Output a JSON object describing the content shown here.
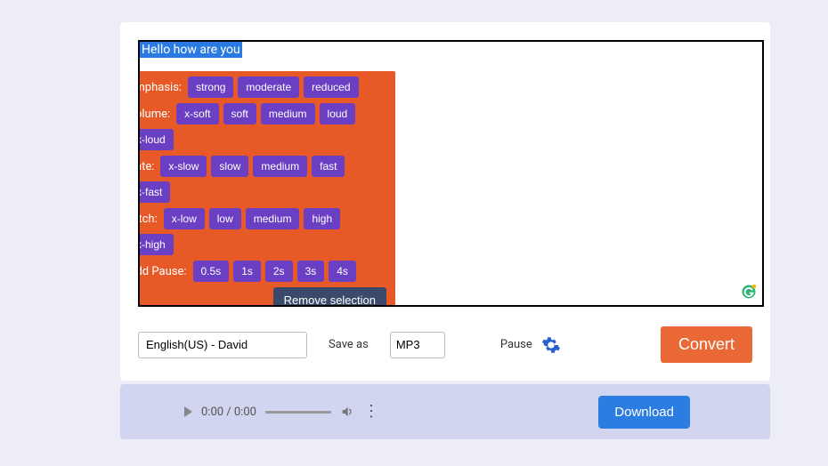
{
  "editor": {
    "selected_text": "Hello how are you"
  },
  "toolbox": {
    "emphasis": {
      "label": "Emphasis:",
      "options": [
        "strong",
        "moderate",
        "reduced"
      ]
    },
    "volume": {
      "label": "Volume:",
      "options": [
        "x-soft",
        "soft",
        "medium",
        "loud",
        "x-loud"
      ]
    },
    "rate": {
      "label": "Rate:",
      "options": [
        "x-slow",
        "slow",
        "medium",
        "fast",
        "x-fast"
      ]
    },
    "pitch": {
      "label": "Pitch:",
      "options": [
        "x-low",
        "low",
        "medium",
        "high",
        "x-high"
      ]
    },
    "pause": {
      "label": "Add Pause:",
      "options": [
        "0.5s",
        "1s",
        "2s",
        "3s",
        "4s"
      ]
    },
    "remove_label": "Remove selection"
  },
  "controls": {
    "voice": "English(US) - David",
    "saveas_label": "Save as",
    "format": "MP3",
    "pause_label": "Pause",
    "convert_label": "Convert"
  },
  "player": {
    "time": "0:00 / 0:00",
    "download_label": "Download"
  }
}
